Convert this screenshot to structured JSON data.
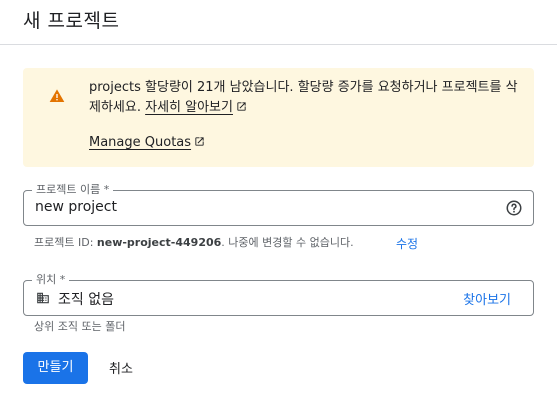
{
  "header": {
    "title": "새 프로젝트"
  },
  "quota_warning": {
    "message": "projects 할당량이 21개 남았습니다. 할당량 증가를 요청하거나 프로젝트를 삭제하세요.",
    "learn_more_label": "자세히 알아보기",
    "manage_quotas_label": "Manage Quotas",
    "icon": "warning-icon",
    "background_color": "#fef7e0",
    "icon_color": "#e37400"
  },
  "project_name": {
    "label": "프로젝트 이름 *",
    "value": "new project",
    "help_icon": "help-circle-icon"
  },
  "project_id_hint": {
    "prefix": "프로젝트 ID: ",
    "id": "new-project-449206",
    "suffix": ". 나중에 변경할 수 없습니다.",
    "edit_label": "수정"
  },
  "location": {
    "label": "위치 *",
    "value": "조직 없음",
    "icon": "building-icon",
    "browse_label": "찾아보기",
    "hint": "상위 조직 또는 폴더"
  },
  "actions": {
    "create_label": "만들기",
    "cancel_label": "취소",
    "primary_color": "#1a73e8"
  }
}
